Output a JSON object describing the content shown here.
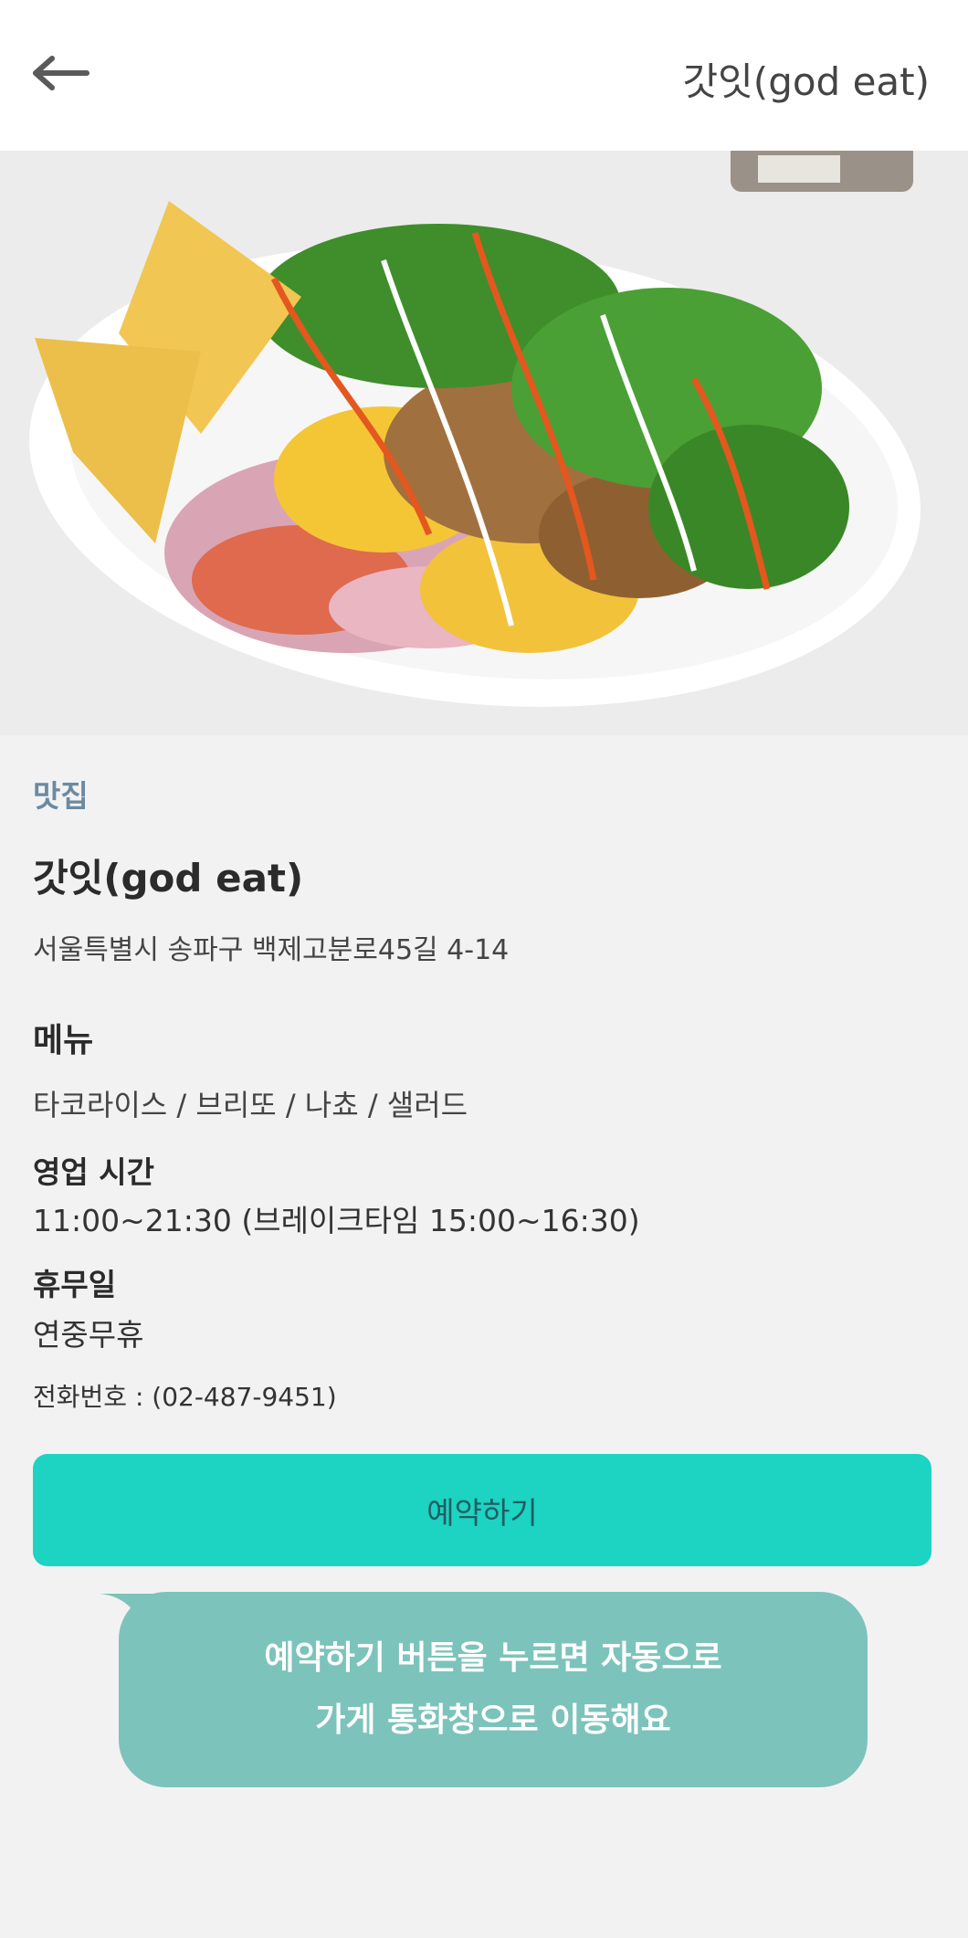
{
  "header": {
    "title": "갓잇(god eat)",
    "back_icon": "arrow-left-icon"
  },
  "hero": {
    "image": "food-bowl-photo"
  },
  "store": {
    "category": "맛집",
    "name": "갓잇(god eat)",
    "address": "서울특별시 송파구 백제고분로45길 4-14",
    "menu_heading": "메뉴",
    "menu_items": "타코라이스 / 브리또 / 나쵸 / 샐러드",
    "hours_heading": "영업 시간",
    "hours_value": "11:00~21:30 (브레이크타임 15:00~16:30)",
    "closed_heading": "휴무일",
    "closed_value": "연중무휴",
    "phone": "전화번호 : (02-487-9451)"
  },
  "actions": {
    "reserve_label": "예약하기"
  },
  "tooltip": {
    "line1": "예약하기 버튼을 누르면 자동으로",
    "line2": "가게 통화창으로 이동해요"
  },
  "colors": {
    "accent": "#1dd3c2",
    "tooltip_bg": "#7cc3bb",
    "category": "#6a8aa2"
  }
}
